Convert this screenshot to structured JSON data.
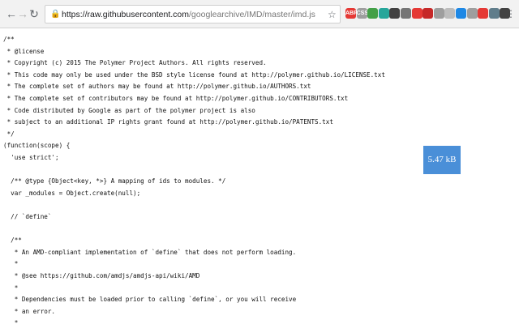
{
  "browser": {
    "nav": {
      "back_icon": "arrow-left-icon",
      "forward_icon": "arrow-right-icon",
      "reload_icon": "reload-icon"
    },
    "address": {
      "url_host": "https://raw.githubusercontent.com",
      "url_path": "/googlearchive/IMD/master/imd.js"
    },
    "extensions": [
      {
        "name": "abp-icon",
        "label": "ABP",
        "color": "#e53935"
      },
      {
        "name": "css-icon",
        "label": "CSS",
        "color": "#9e9e9e"
      },
      {
        "name": "green-ext-icon",
        "label": "",
        "color": "#43a047"
      },
      {
        "name": "teal-ext-icon",
        "label": "",
        "color": "#26a69a"
      },
      {
        "name": "dark-square-icon",
        "label": "",
        "color": "#424242"
      },
      {
        "name": "grey-square-icon",
        "label": "",
        "color": "#757575"
      },
      {
        "name": "red-circle-icon",
        "label": "",
        "color": "#e53935"
      },
      {
        "name": "red-square-icon",
        "label": "",
        "color": "#c62828"
      },
      {
        "name": "grey-circle-icon",
        "label": "",
        "color": "#9e9e9e"
      },
      {
        "name": "light-circle-icon",
        "label": "",
        "color": "#bdbdbd"
      },
      {
        "name": "blue-circle-icon",
        "label": "",
        "color": "#1e88e5"
      },
      {
        "name": "grey-ring-icon",
        "label": "",
        "color": "#9e9e9e"
      },
      {
        "name": "red-ring-icon",
        "label": "",
        "color": "#e53935"
      },
      {
        "name": "globe-icon",
        "label": "",
        "color": "#607d8b"
      },
      {
        "name": "flag-icon",
        "label": "",
        "color": "#424242"
      }
    ]
  },
  "code_lines": [
    "/**",
    " * @license",
    " * Copyright (c) 2015 The Polymer Project Authors. All rights reserved.",
    " * This code may only be used under the BSD style license found at http://polymer.github.io/LICENSE.txt",
    " * The complete set of authors may be found at http://polymer.github.io/AUTHORS.txt",
    " * The complete set of contributors may be found at http://polymer.github.io/CONTRIBUTORS.txt",
    " * Code distributed by Google as part of the polymer project is also",
    " * subject to an additional IP rights grant found at http://polymer.github.io/PATENTS.txt",
    " */",
    "(function(scope) {",
    "  'use strict';",
    "",
    "  /** @type {Object<key, *>} A mapping of ids to modules. */",
    "  var _modules = Object.create(null);",
    "",
    "  // `define`",
    "",
    "  /**",
    "   * An AMD-compliant implementation of `define` that does not perform loading.",
    "   *",
    "   * @see https://github.com/amdjs/amdjs-api/wiki/AMD",
    "   *",
    "   * Dependencies must be loaded prior to calling `define`, or you will receive",
    "   * an error.",
    "   *"
  ],
  "size_badge": "5.47 kB"
}
